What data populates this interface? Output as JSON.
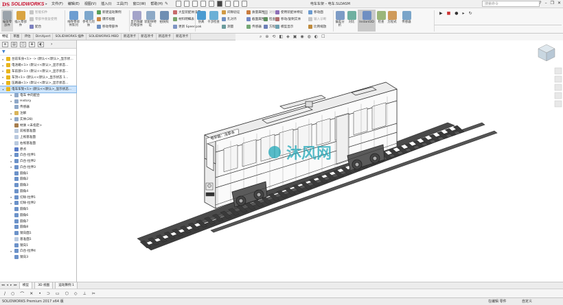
{
  "app": {
    "logo": "SOLIDWORKS",
    "doc_title": "电车车架 – 电车.SLDASM"
  },
  "menus": [
    "文件(F)",
    "编辑(E)",
    "视图(V)",
    "插入(I)",
    "工具(T)",
    "窗口(W)",
    "帮助(H)"
  ],
  "search": {
    "placeholder": "搜索命令"
  },
  "ribbon": {
    "edit_component": "编辑零部件",
    "insert_component": "插入零部件",
    "smart_fastener": "智能扣件",
    "virtual_component": "零部件重复使用",
    "mate": "配合",
    "linear_pattern": "线性零部件阵列",
    "reference_geometry": "参考几何体",
    "new_motion_study": "新建运动算例",
    "explode_view": "爆炸视图",
    "move_component": "移动零部件",
    "show_hidden": "显示隐藏的零部件",
    "assembly_features": "装配体特征",
    "instant3d": "Instant3D",
    "update_speedpak": "更新 Speedpak",
    "take_snapshot": "拍快照",
    "large_assembly": "大型装配体设置",
    "bill_of_materials": "材料明细表",
    "interference": "干涉检查",
    "clearance": "间隙验证",
    "hole_alignment": "孔对齐",
    "measure": "测量",
    "mass_props": "质量属性",
    "section_props": "截面属性",
    "sensor": "传感器",
    "compare": "对比",
    "check": "检查",
    "equations": "方程式",
    "import_diag": "输入诊断",
    "deviation": "偏差分析",
    "use_parts": "使用装配体特征",
    "copy_entities": "移动/复制实体",
    "view_cond": "模型显示",
    "move_face": "移动面",
    "sim": "仿真",
    "feature_x": "比例缩放"
  },
  "tabs": [
    {
      "label": "特征",
      "active": true
    },
    {
      "label": "草图",
      "active": false
    },
    {
      "label": "评估",
      "active": false
    },
    {
      "label": "DimXpert",
      "active": false
    },
    {
      "label": "SOLIDWORKS 插件",
      "active": false
    },
    {
      "label": "SOLIDWORKS MBD",
      "active": false
    },
    {
      "label": "新选项卡",
      "active": false
    },
    {
      "label": "新选项卡",
      "active": false
    },
    {
      "label": "新选项卡",
      "active": false
    },
    {
      "label": "新选项卡",
      "active": false
    }
  ],
  "tree": [
    {
      "label": "台前车身<1> -> (默认<<默认>_显示状态...",
      "indent": 0,
      "expander": "▸",
      "icon": "#e8b51d"
    },
    {
      "label": "电池箱<1> (默认<<默认>_显示状态...",
      "indent": 0,
      "expander": "▸",
      "icon": "#e8b51d"
    },
    {
      "label": "车前部<1> (默认<<默认>_显示状态...",
      "indent": 0,
      "expander": "▸",
      "icon": "#e8b51d"
    },
    {
      "label": "车顶<1> (默认<<默认>_显示状态 1...",
      "indent": 0,
      "expander": "▸",
      "icon": "#e8b51d"
    },
    {
      "label": "压路器<1> (默认<<默认>_显示状态...",
      "indent": 0,
      "expander": "▸",
      "icon": "#e8b51d"
    },
    {
      "label": "电车车架<1> (默认<<默认>_显示状态...",
      "indent": 0,
      "expander": "▾",
      "icon": "#e8b51d",
      "selected": true
    },
    {
      "label": "电车 中的配合",
      "indent": 1,
      "expander": "▸",
      "icon": "#8fa8c8"
    },
    {
      "label": "History",
      "indent": 1,
      "expander": "▸",
      "icon": "#8fa8c8"
    },
    {
      "label": "传感器",
      "indent": 1,
      "expander": "",
      "icon": "#8fa8c8"
    },
    {
      "label": "注解",
      "indent": 1,
      "expander": "▸",
      "icon": "#d9b45a"
    },
    {
      "label": "实体(28)",
      "indent": 1,
      "expander": "▸",
      "icon": "#8fa8c8"
    },
    {
      "label": "材质 <未指定>",
      "indent": 1,
      "expander": "",
      "icon": "#a77e4e"
    },
    {
      "label": "前视基准面",
      "indent": 1,
      "expander": "",
      "icon": "#b9c9de"
    },
    {
      "label": "上视基准面",
      "indent": 1,
      "expander": "",
      "icon": "#b9c9de"
    },
    {
      "label": "右视基准面",
      "indent": 1,
      "expander": "",
      "icon": "#b9c9de"
    },
    {
      "label": "原点",
      "indent": 1,
      "expander": "",
      "icon": "#5a7cc8"
    },
    {
      "label": "凸台-拉伸1",
      "indent": 1,
      "expander": "▸",
      "icon": "#6c92c9"
    },
    {
      "label": "凸台-拉伸2",
      "indent": 1,
      "expander": "▸",
      "icon": "#6c92c9"
    },
    {
      "label": "凸台-拉伸3",
      "indent": 1,
      "expander": "▸",
      "icon": "#6c92c9"
    },
    {
      "label": "圆角1",
      "indent": 1,
      "expander": "",
      "icon": "#6c92c9"
    },
    {
      "label": "圆角2",
      "indent": 1,
      "expander": "",
      "icon": "#6c92c9"
    },
    {
      "label": "圆角3",
      "indent": 1,
      "expander": "",
      "icon": "#6c92c9"
    },
    {
      "label": "圆角4",
      "indent": 1,
      "expander": "",
      "icon": "#6c92c9"
    },
    {
      "label": "切除-拉伸1",
      "indent": 1,
      "expander": "▸",
      "icon": "#6c92c9"
    },
    {
      "label": "切除-拉伸2",
      "indent": 1,
      "expander": "▸",
      "icon": "#6c92c9"
    },
    {
      "label": "圆角5",
      "indent": 1,
      "expander": "",
      "icon": "#6c92c9"
    },
    {
      "label": "圆角6",
      "indent": 1,
      "expander": "",
      "icon": "#6c92c9"
    },
    {
      "label": "圆角7",
      "indent": 1,
      "expander": "",
      "icon": "#6c92c9"
    },
    {
      "label": "圆角8",
      "indent": 1,
      "expander": "",
      "icon": "#6c92c9"
    },
    {
      "label": "镜向面1",
      "indent": 1,
      "expander": "",
      "icon": "#6c92c9"
    },
    {
      "label": "基准面1",
      "indent": 1,
      "expander": "",
      "icon": "#b9c9de"
    },
    {
      "label": "镜向1",
      "indent": 1,
      "expander": "",
      "icon": "#6c92c9"
    },
    {
      "label": "凸台-拉伸4",
      "indent": 1,
      "expander": "▸",
      "icon": "#6c92c9"
    },
    {
      "label": "镜向3",
      "indent": 1,
      "expander": "",
      "icon": "#6c92c9"
    }
  ],
  "bottom_tabs": [
    "模型",
    "3D 视图",
    "运动算例 1"
  ],
  "train_sign": "电车路：浅草寺",
  "watermark": "沐风网",
  "status": {
    "left": "SOLIDWORKS Premium 2017 x64 版",
    "mid": "在编辑 零件",
    "right": "自定义"
  },
  "colors": {
    "accent": "#c8102e",
    "selection": "#cde4fb",
    "watermark": "#1aa6b7"
  }
}
